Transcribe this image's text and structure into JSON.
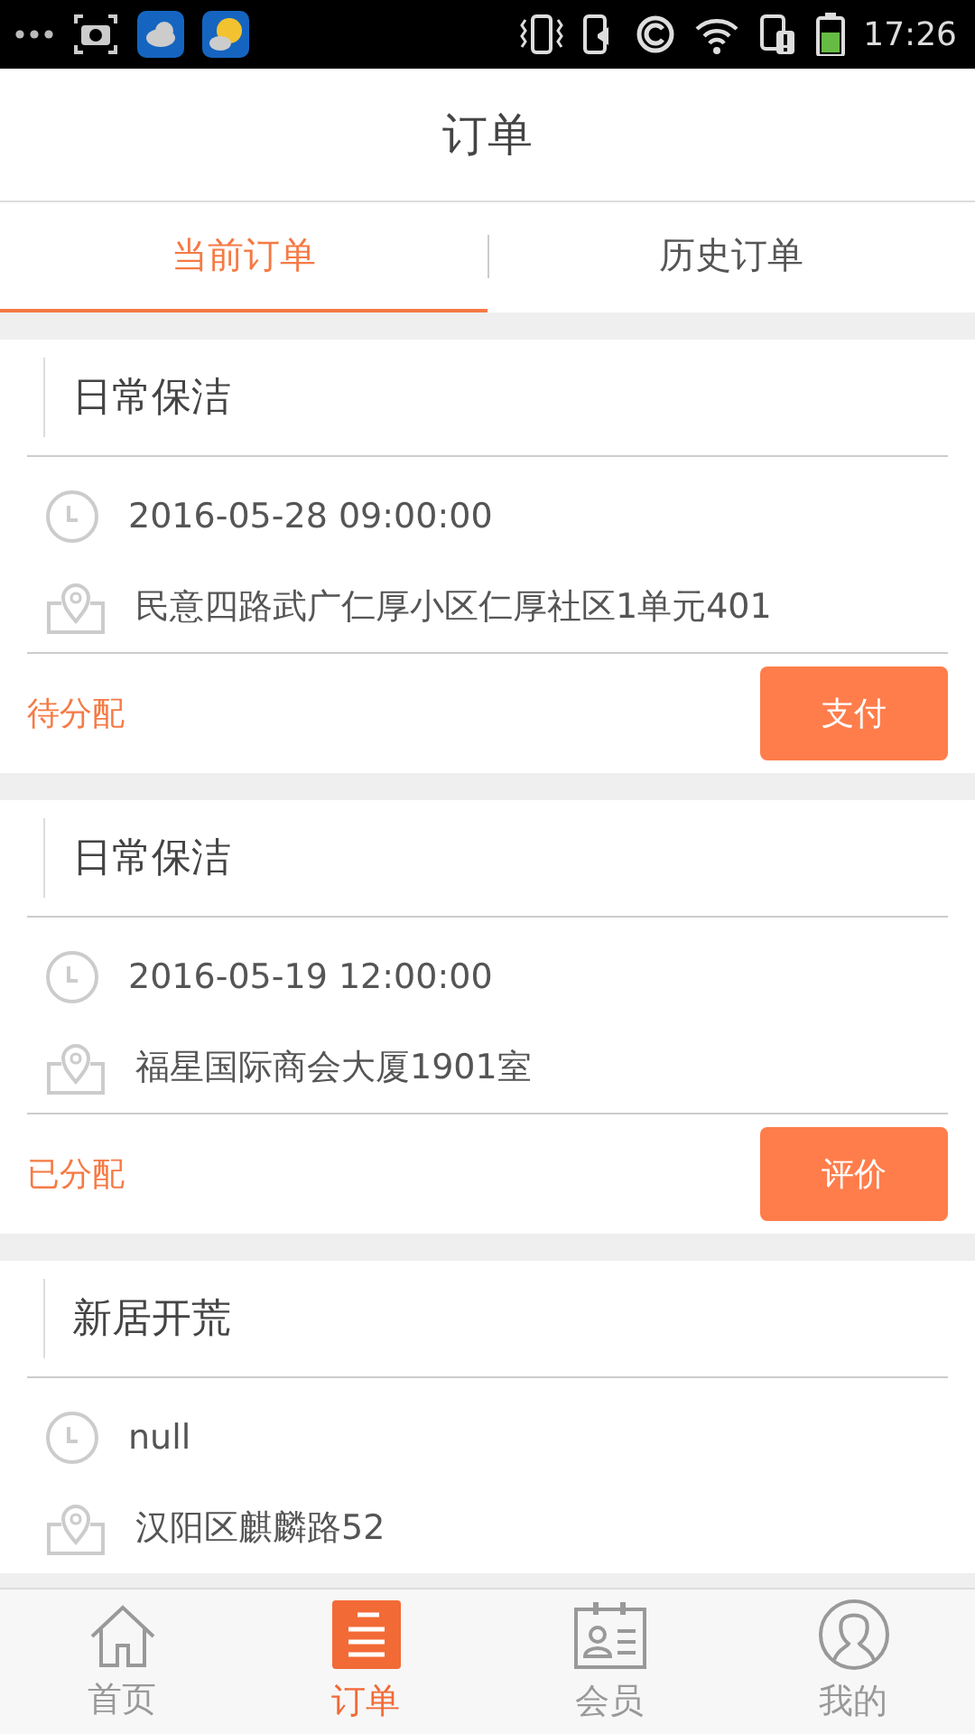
{
  "status_bar": {
    "time": "17:26"
  },
  "header": {
    "title": "订单"
  },
  "tabs": [
    {
      "label": "当前订单",
      "selected": true
    },
    {
      "label": "历史订单",
      "selected": false
    }
  ],
  "orders": [
    {
      "service": "日常保洁",
      "time": "2016-05-28 09:00:00",
      "address": "民意四路武广仁厚小区仁厚社区1单元401",
      "status": "待分配",
      "action": "支付"
    },
    {
      "service": "日常保洁",
      "time": "2016-05-19 12:00:00",
      "address": "福星国际商会大厦1901室",
      "status": "已分配",
      "action": "评价"
    },
    {
      "service": "新居开荒",
      "time": "null",
      "address": "汉阳区麒麟路52"
    }
  ],
  "bottom_nav": [
    {
      "label": "首页",
      "selected": false
    },
    {
      "label": "订单",
      "selected": true
    },
    {
      "label": "会员",
      "selected": false
    },
    {
      "label": "我的",
      "selected": false
    }
  ]
}
